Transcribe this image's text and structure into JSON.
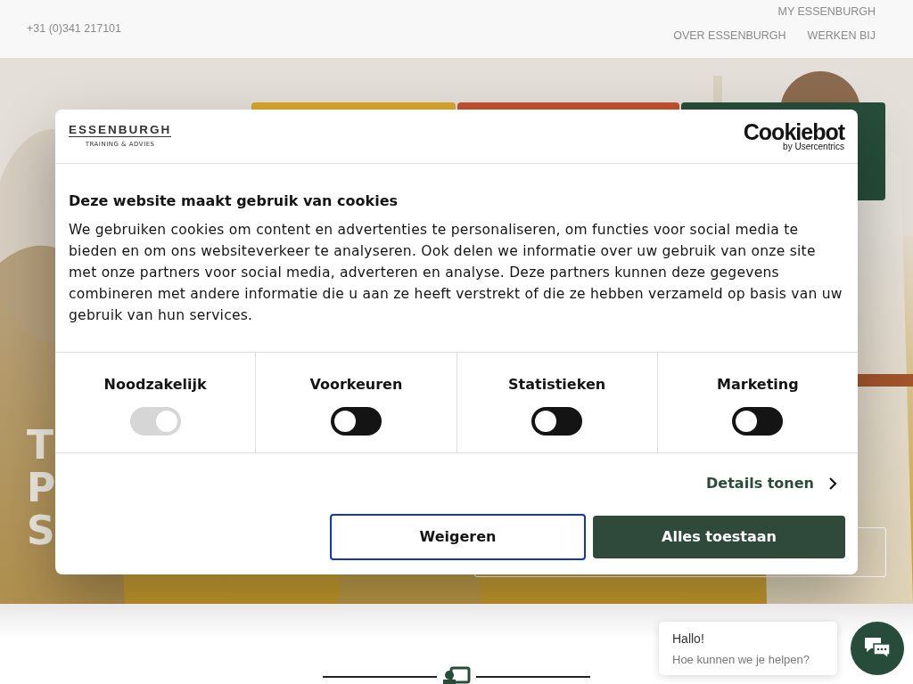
{
  "header": {
    "phone": "+31 (0)341 217101",
    "top_links": [
      {
        "label": "MY ESSENBURGH"
      }
    ],
    "nav_links": [
      {
        "label": "OVER ESSENBURGH"
      },
      {
        "label": "WERKEN BIJ"
      }
    ]
  },
  "hero": {
    "kind": "picture",
    "heading_lines": [
      "T",
      "P",
      "S"
    ],
    "tabs": [
      {
        "color": "#dba727"
      },
      {
        "color": "#c6512e"
      },
      {
        "color": "#274d3a"
      }
    ]
  },
  "cookie_dialog": {
    "brand": "ESSENBURGH",
    "brand_tagline": "TRAINING & ADVIES",
    "provider": "Cookiebot",
    "provider_sub": "by Usercentrics",
    "title": "Deze website maakt gebruik van cookies",
    "body": "We gebruiken cookies om content en advertenties te personaliseren, om functies voor social media te bieden en om ons websiteverkeer te analyseren. Ook delen we informatie over uw gebruik van onze site met onze partners voor social media, adverteren en analyse. Deze partners kunnen deze gegevens combineren met andere informatie die u aan ze heeft verstrekt of die ze hebben verzameld op basis van uw gebruik van hun services.",
    "categories": [
      {
        "label": "Noodzakelijk",
        "checked": true,
        "disabled": true
      },
      {
        "label": "Voorkeuren",
        "checked": false,
        "disabled": false
      },
      {
        "label": "Statistieken",
        "checked": false,
        "disabled": false
      },
      {
        "label": "Marketing",
        "checked": false,
        "disabled": false
      }
    ],
    "details_link": "Details tonen",
    "buttons": [
      {
        "label": "Weigeren",
        "kind": "outline"
      },
      {
        "label": "Alles toestaan",
        "kind": "primary"
      }
    ]
  },
  "chat": {
    "greeting": "Hallo!",
    "prompt": "Hoe kunnen we je helpen?"
  }
}
